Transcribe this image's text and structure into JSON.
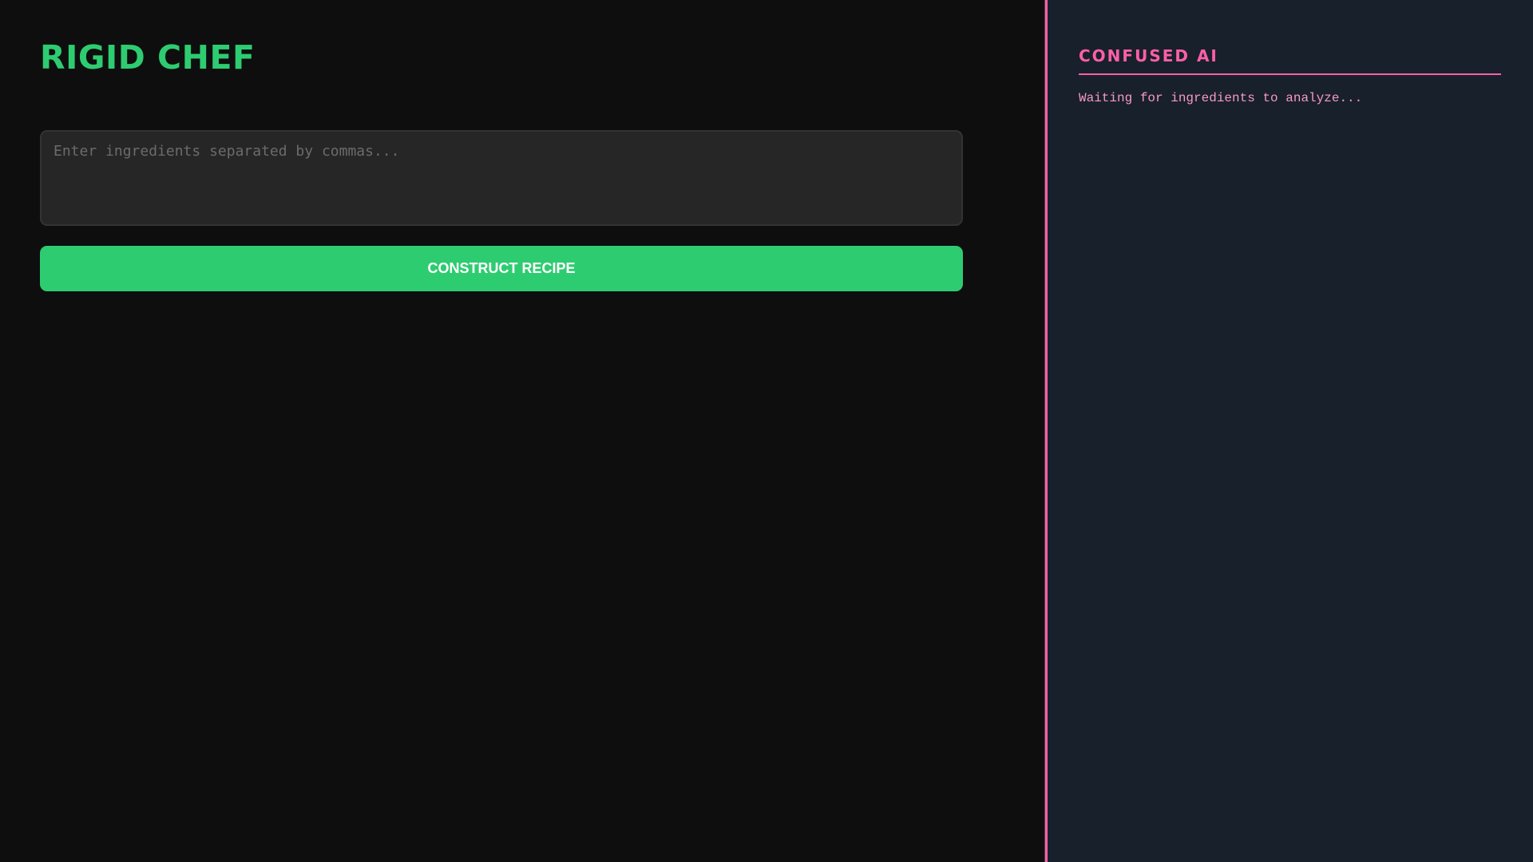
{
  "left": {
    "title": "RIGID CHEF",
    "ingredients_input": {
      "value": "",
      "placeholder": "Enter ingredients separated by commas..."
    },
    "construct_button": "CONSTRUCT RECIPE"
  },
  "right": {
    "title": "CONFUSED AI",
    "status": "Waiting for ingredients to analyze..."
  },
  "colors": {
    "accent_green": "#2ecc71",
    "accent_pink": "#ff5fa8",
    "left_bg": "#0e0e0e",
    "right_bg": "#18202b"
  }
}
